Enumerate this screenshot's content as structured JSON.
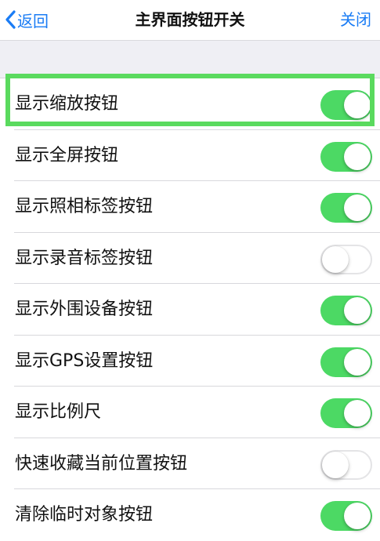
{
  "navbar": {
    "back_label": "返回",
    "title": "主界面按钮开关",
    "close_label": "关闭"
  },
  "colors": {
    "accent": "#1a7cf5",
    "toggle_on": "#4cd964",
    "highlight": "#5ada5e"
  },
  "settings": {
    "items": [
      {
        "label": "显示缩放按钮",
        "enabled": true
      },
      {
        "label": "显示全屏按钮",
        "enabled": true
      },
      {
        "label": "显示照相标签按钮",
        "enabled": true
      },
      {
        "label": "显示录音标签按钮",
        "enabled": false
      },
      {
        "label": "显示外围设备按钮",
        "enabled": true
      },
      {
        "label": "显示GPS设置按钮",
        "enabled": true
      },
      {
        "label": "显示比例尺",
        "enabled": true
      },
      {
        "label": "快速收藏当前位置按钮",
        "enabled": false
      },
      {
        "label": "清除临时对象按钮",
        "enabled": true
      }
    ]
  }
}
